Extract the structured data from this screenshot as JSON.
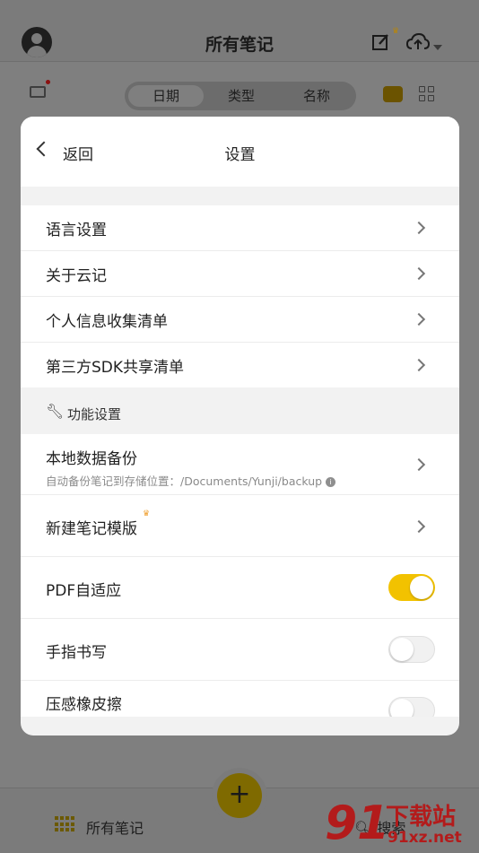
{
  "app": {
    "title": "所有笔记",
    "segments": [
      {
        "label": "日期",
        "active": true
      },
      {
        "label": "类型",
        "active": false
      },
      {
        "label": "名称",
        "active": false
      }
    ],
    "bottom_tabs": {
      "all_notes": "所有笔记",
      "search": "搜索"
    },
    "fab_symbol": "+",
    "icons": [
      "avatar-icon",
      "edit-icon",
      "cloud-upload-icon",
      "mail-icon",
      "treasure-chest-icon",
      "grid-view-icon"
    ]
  },
  "watermark": {
    "brand": "91",
    "text": "下载站",
    "url": "91xz.net"
  },
  "modal": {
    "back_label": "返回",
    "title": "设置",
    "items": [
      {
        "label": "语言设置"
      },
      {
        "label": "关于云记"
      },
      {
        "label": "个人信息收集清单"
      },
      {
        "label": "第三方SDK共享清单"
      }
    ],
    "section_title": "功能设置",
    "feature_items": [
      {
        "label": "本地数据备份",
        "sub": "自动备份笔记到存储位置：/Documents/Yunji/backup"
      },
      {
        "label": "新建笔记模版",
        "premium": true
      },
      {
        "label": "PDF自适应",
        "toggle": true,
        "on": true
      },
      {
        "label": "手指书写",
        "toggle": true,
        "on": false
      },
      {
        "label": "压感橡皮擦",
        "toggle": true,
        "on": false
      }
    ]
  },
  "colors": {
    "accent": "#f2c200",
    "crown": "#f0a030"
  }
}
